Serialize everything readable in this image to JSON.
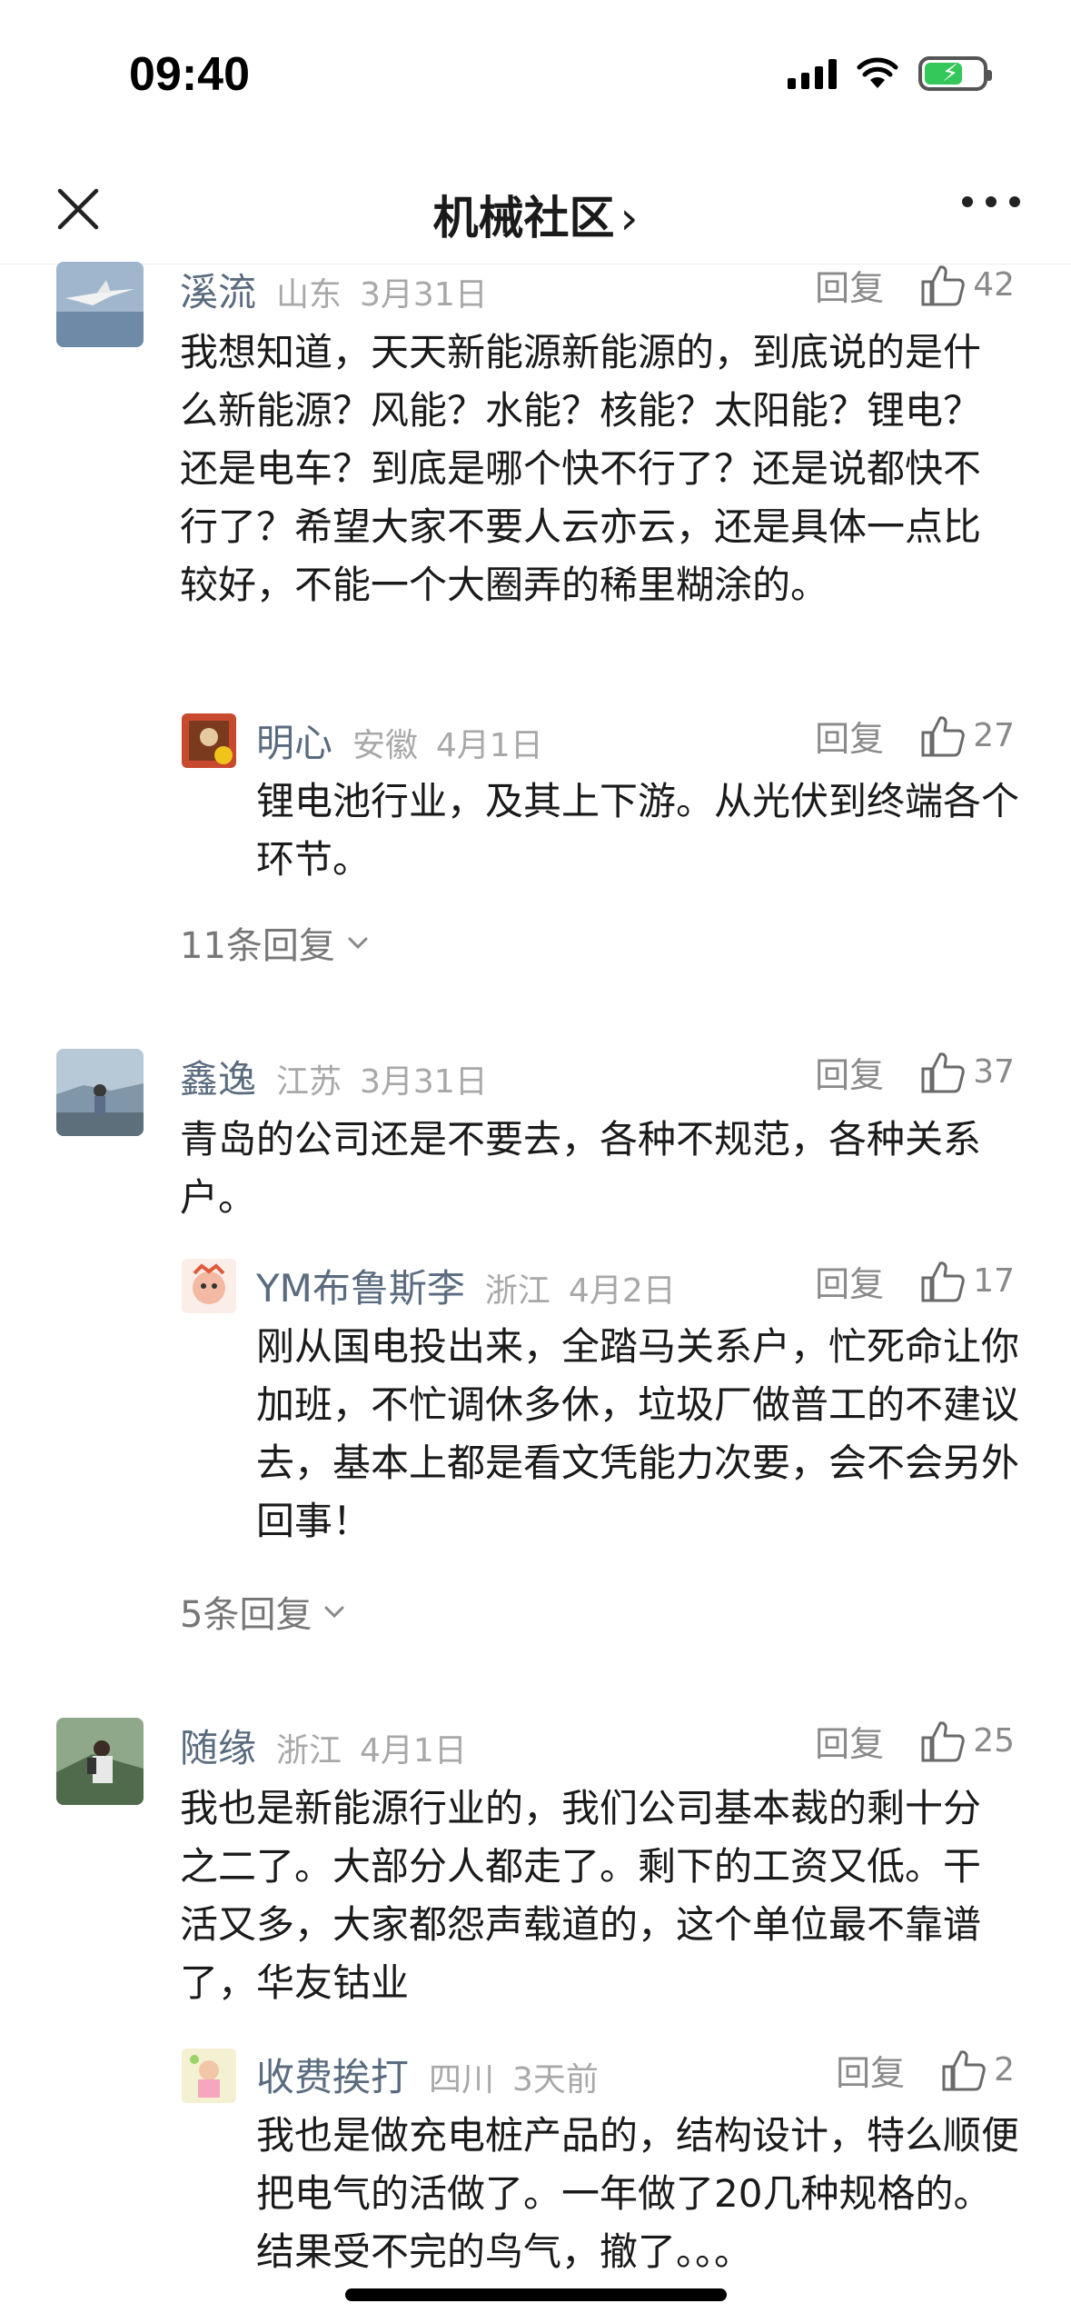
{
  "status": {
    "time": "09:40"
  },
  "nav": {
    "title": "机械社区",
    "chevron": "›"
  },
  "reply_label": "回复",
  "comments": [
    {
      "user": "溪流",
      "location": "山东",
      "date": "3月31日",
      "likes": "42",
      "text": "我想知道，天天新能源新能源的，到底说的是什么新能源？风能？水能？核能？太阳能？锂电？还是电车？到底是哪个快不行了？还是说都快不行了？希望大家不要人云亦云，还是具体一点比较好，不能一个大圈弄的稀里糊涂的。",
      "reply": {
        "user": "明心",
        "location": "安徽",
        "date": "4月1日",
        "likes": "27",
        "text": "锂电池行业，及其上下游。从光伏到终端各个环节。"
      },
      "more_replies": "11条回复"
    },
    {
      "user": "鑫逸",
      "location": "江苏",
      "date": "3月31日",
      "likes": "37",
      "text": "青岛的公司还是不要去，各种不规范，各种关系户。",
      "reply": {
        "user": "YM布鲁斯李",
        "location": "浙江",
        "date": "4月2日",
        "likes": "17",
        "text": "刚从国电投出来，全踏马关系户，忙死命让你加班，不忙调休多休，垃圾厂做普工的不建议去，基本上都是看文凭能力次要，会不会另外回事！"
      },
      "more_replies": "5条回复"
    },
    {
      "user": "随缘",
      "location": "浙江",
      "date": "4月1日",
      "likes": "25",
      "text": "我也是新能源行业的，我们公司基本裁的剩十分之二了。大部分人都走了。剩下的工资又低。干活又多，大家都怨声载道的，这个单位最不靠谱了，华友钴业",
      "reply": {
        "user": "收费挨打",
        "location": "四川",
        "date": "3天前",
        "likes": "2",
        "text": "我也是做充电桩产品的，结构设计，特么顺便把电气的活做了。一年做了20几种规格的。结果受不完的鸟气，撤了。。。"
      }
    }
  ],
  "colors": {
    "username": "#5a6b7f",
    "meta": "#a8a8a8",
    "battery_green": "#34c759"
  },
  "icons": [
    "close-icon",
    "chevron-right-icon",
    "more-icon",
    "thumbs-up-icon",
    "chevron-down-icon",
    "signal-icon",
    "wifi-icon",
    "battery-icon"
  ]
}
